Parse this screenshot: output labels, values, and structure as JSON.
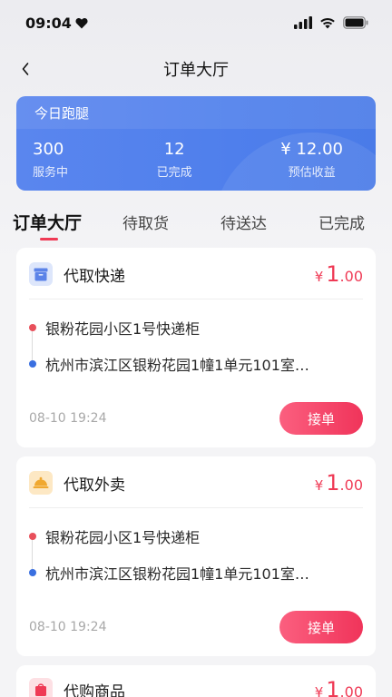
{
  "status_bar": {
    "time": "09:04"
  },
  "nav": {
    "title": "订单大厅"
  },
  "summary": {
    "title": "今日跑腿",
    "stats": [
      {
        "value": "300",
        "label": "服务中"
      },
      {
        "value": "12",
        "label": "已完成"
      },
      {
        "value": "¥ 12.00",
        "label": "预估收益"
      }
    ]
  },
  "tabs": [
    {
      "label": "订单大厅",
      "active": true
    },
    {
      "label": "待取货",
      "active": false
    },
    {
      "label": "待送达",
      "active": false
    },
    {
      "label": "已完成",
      "active": false
    }
  ],
  "colors": {
    "accent": "#ef3a55",
    "summary_blue": "#4f7fec",
    "pickup_dot": "#e8505b",
    "dropoff_dot": "#3a6fe0"
  },
  "orders": [
    {
      "type": "代取快递",
      "icon": "package-box-icon",
      "price_currency": "¥",
      "price_int": "1",
      "price_dec": ".00",
      "pickup": "银粉花园小区1号快递柜",
      "dropoff": "杭州市滨江区银粉花园1幢1单元101室…",
      "time": "08-10 19:24",
      "button": "接单"
    },
    {
      "type": "代取外卖",
      "icon": "food-cloche-icon",
      "price_currency": "¥",
      "price_int": "1",
      "price_dec": ".00",
      "pickup": "银粉花园小区1号快递柜",
      "dropoff": "杭州市滨江区银粉花园1幢1单元101室…",
      "time": "08-10 19:24",
      "button": "接单"
    },
    {
      "type": "代购商品",
      "icon": "shopping-bag-icon",
      "price_currency": "¥",
      "price_int": "1",
      "price_dec": ".00"
    }
  ]
}
